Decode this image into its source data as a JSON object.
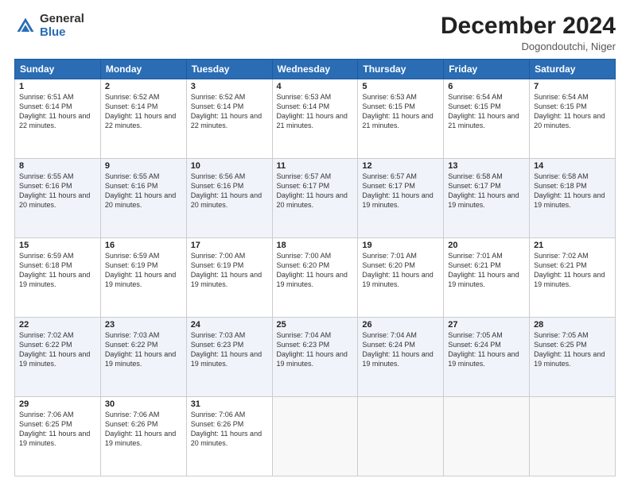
{
  "logo": {
    "general": "General",
    "blue": "Blue"
  },
  "header": {
    "month": "December 2024",
    "location": "Dogondoutchi, Niger"
  },
  "days_of_week": [
    "Sunday",
    "Monday",
    "Tuesday",
    "Wednesday",
    "Thursday",
    "Friday",
    "Saturday"
  ],
  "weeks": [
    [
      {
        "day": "1",
        "sunrise": "6:51 AM",
        "sunset": "6:14 PM",
        "daylight": "11 hours and 22 minutes."
      },
      {
        "day": "2",
        "sunrise": "6:52 AM",
        "sunset": "6:14 PM",
        "daylight": "11 hours and 22 minutes."
      },
      {
        "day": "3",
        "sunrise": "6:52 AM",
        "sunset": "6:14 PM",
        "daylight": "11 hours and 22 minutes."
      },
      {
        "day": "4",
        "sunrise": "6:53 AM",
        "sunset": "6:14 PM",
        "daylight": "11 hours and 21 minutes."
      },
      {
        "day": "5",
        "sunrise": "6:53 AM",
        "sunset": "6:15 PM",
        "daylight": "11 hours and 21 minutes."
      },
      {
        "day": "6",
        "sunrise": "6:54 AM",
        "sunset": "6:15 PM",
        "daylight": "11 hours and 21 minutes."
      },
      {
        "day": "7",
        "sunrise": "6:54 AM",
        "sunset": "6:15 PM",
        "daylight": "11 hours and 20 minutes."
      }
    ],
    [
      {
        "day": "8",
        "sunrise": "6:55 AM",
        "sunset": "6:16 PM",
        "daylight": "11 hours and 20 minutes."
      },
      {
        "day": "9",
        "sunrise": "6:55 AM",
        "sunset": "6:16 PM",
        "daylight": "11 hours and 20 minutes."
      },
      {
        "day": "10",
        "sunrise": "6:56 AM",
        "sunset": "6:16 PM",
        "daylight": "11 hours and 20 minutes."
      },
      {
        "day": "11",
        "sunrise": "6:57 AM",
        "sunset": "6:17 PM",
        "daylight": "11 hours and 20 minutes."
      },
      {
        "day": "12",
        "sunrise": "6:57 AM",
        "sunset": "6:17 PM",
        "daylight": "11 hours and 19 minutes."
      },
      {
        "day": "13",
        "sunrise": "6:58 AM",
        "sunset": "6:17 PM",
        "daylight": "11 hours and 19 minutes."
      },
      {
        "day": "14",
        "sunrise": "6:58 AM",
        "sunset": "6:18 PM",
        "daylight": "11 hours and 19 minutes."
      }
    ],
    [
      {
        "day": "15",
        "sunrise": "6:59 AM",
        "sunset": "6:18 PM",
        "daylight": "11 hours and 19 minutes."
      },
      {
        "day": "16",
        "sunrise": "6:59 AM",
        "sunset": "6:19 PM",
        "daylight": "11 hours and 19 minutes."
      },
      {
        "day": "17",
        "sunrise": "7:00 AM",
        "sunset": "6:19 PM",
        "daylight": "11 hours and 19 minutes."
      },
      {
        "day": "18",
        "sunrise": "7:00 AM",
        "sunset": "6:20 PM",
        "daylight": "11 hours and 19 minutes."
      },
      {
        "day": "19",
        "sunrise": "7:01 AM",
        "sunset": "6:20 PM",
        "daylight": "11 hours and 19 minutes."
      },
      {
        "day": "20",
        "sunrise": "7:01 AM",
        "sunset": "6:21 PM",
        "daylight": "11 hours and 19 minutes."
      },
      {
        "day": "21",
        "sunrise": "7:02 AM",
        "sunset": "6:21 PM",
        "daylight": "11 hours and 19 minutes."
      }
    ],
    [
      {
        "day": "22",
        "sunrise": "7:02 AM",
        "sunset": "6:22 PM",
        "daylight": "11 hours and 19 minutes."
      },
      {
        "day": "23",
        "sunrise": "7:03 AM",
        "sunset": "6:22 PM",
        "daylight": "11 hours and 19 minutes."
      },
      {
        "day": "24",
        "sunrise": "7:03 AM",
        "sunset": "6:23 PM",
        "daylight": "11 hours and 19 minutes."
      },
      {
        "day": "25",
        "sunrise": "7:04 AM",
        "sunset": "6:23 PM",
        "daylight": "11 hours and 19 minutes."
      },
      {
        "day": "26",
        "sunrise": "7:04 AM",
        "sunset": "6:24 PM",
        "daylight": "11 hours and 19 minutes."
      },
      {
        "day": "27",
        "sunrise": "7:05 AM",
        "sunset": "6:24 PM",
        "daylight": "11 hours and 19 minutes."
      },
      {
        "day": "28",
        "sunrise": "7:05 AM",
        "sunset": "6:25 PM",
        "daylight": "11 hours and 19 minutes."
      }
    ],
    [
      {
        "day": "29",
        "sunrise": "7:06 AM",
        "sunset": "6:25 PM",
        "daylight": "11 hours and 19 minutes."
      },
      {
        "day": "30",
        "sunrise": "7:06 AM",
        "sunset": "6:26 PM",
        "daylight": "11 hours and 19 minutes."
      },
      {
        "day": "31",
        "sunrise": "7:06 AM",
        "sunset": "6:26 PM",
        "daylight": "11 hours and 20 minutes."
      },
      null,
      null,
      null,
      null
    ]
  ]
}
